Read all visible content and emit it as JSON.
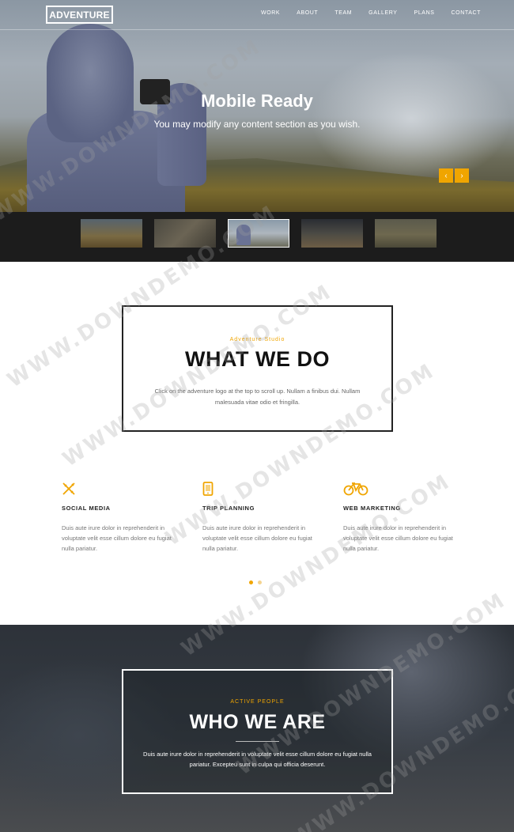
{
  "header": {
    "logo": "ADVENTURE",
    "nav": [
      "WORK",
      "ABOUT",
      "TEAM",
      "GALLERY",
      "PLANS",
      "CONTACT"
    ]
  },
  "hero": {
    "title": "Mobile Ready",
    "subtitle": "You may modify any content section as you wish.",
    "prev_icon": "chevron-left-icon",
    "next_icon": "chevron-right-icon",
    "prev_glyph": "‹",
    "next_glyph": "›"
  },
  "thumbnails": {
    "count": 5,
    "active_index": 3
  },
  "what_we_do": {
    "kicker": "Adventure Studio",
    "title": "WHAT WE DO",
    "text": "Click on the adventure logo at the top to scroll up. Nullam a finibus dui. Nullam malesuada vitae odio et fringilla."
  },
  "features": [
    {
      "icon": "pencil-ruler-icon",
      "title": "SOCIAL MEDIA",
      "text": "Duis aute irure dolor in reprehenderit in voluptate velit esse cillum dolore eu fugiat nulla pariatur."
    },
    {
      "icon": "tablet-icon",
      "title": "TRIP PLANNING",
      "text": "Duis aute irure dolor in reprehenderit in voluptate velit esse cillum dolore eu fugiat nulla pariatur."
    },
    {
      "icon": "bicycle-icon",
      "title": "WEB MARKETING",
      "text": "Duis aute irure dolor in reprehenderit in voluptate velit esse cillum dolore eu fugiat nulla pariatur."
    }
  ],
  "carousel": {
    "pages": 2,
    "active": 1
  },
  "who_we_are": {
    "kicker": "ACTIVE PEOPLE",
    "title": "WHO WE ARE",
    "text": "Duis aute irure dolor in reprehenderit in voluptate velit esse cillum dolore eu fugiat nulla pariatur. Excepteu sunt in culpa qui officia deserunt."
  },
  "watermark": "WWW.DOWNDEMO.COM",
  "colors": {
    "accent": "#f0a500",
    "dark": "#1c1c1c",
    "text": "#222222"
  }
}
